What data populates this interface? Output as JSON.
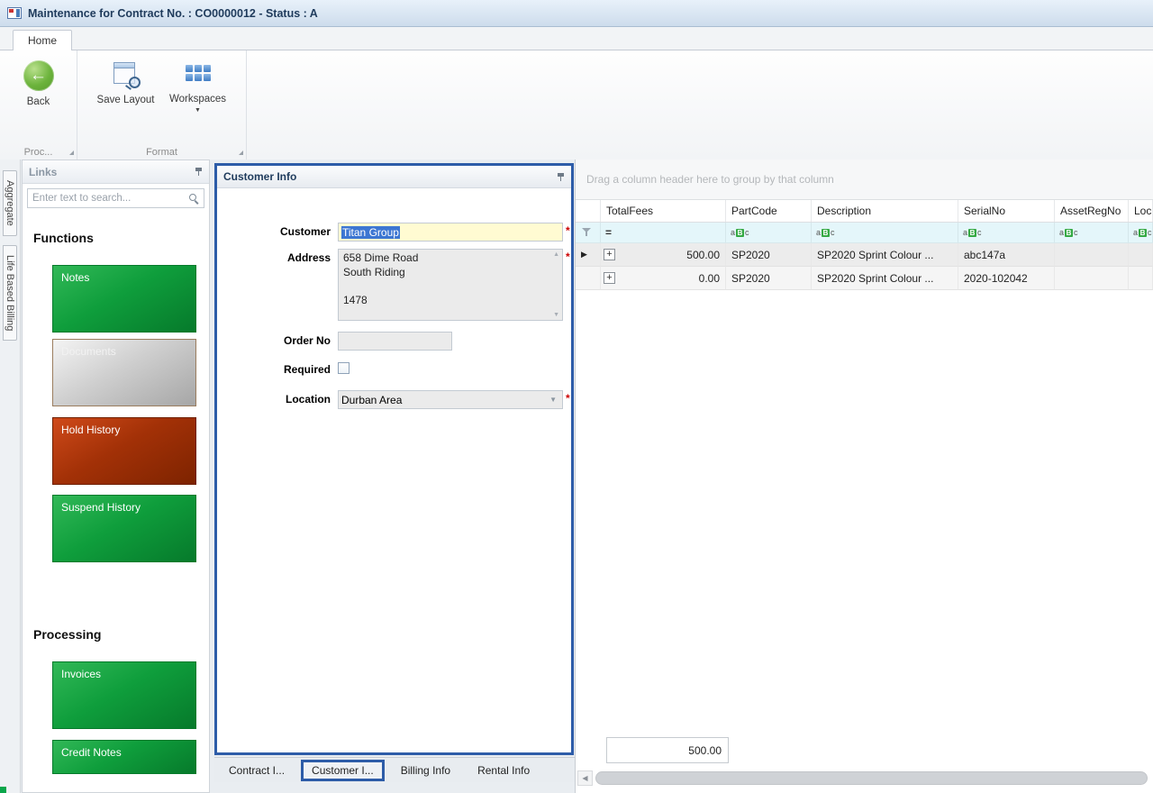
{
  "window": {
    "title": "Maintenance for Contract No. : CO0000012 - Status : A"
  },
  "ribbon": {
    "tabs": [
      {
        "label": "Home"
      }
    ],
    "buttons": [
      {
        "label": "Back"
      },
      {
        "label": "Save Layout"
      },
      {
        "label": "Workspaces"
      }
    ],
    "groups": [
      {
        "label": "Proc..."
      },
      {
        "label": "Format"
      }
    ]
  },
  "side_tabs": [
    "Aggregate",
    "Life Based Billing"
  ],
  "links_panel": {
    "title": "Links",
    "search_placeholder": "Enter text to search...",
    "sections": [
      {
        "heading": "Functions",
        "buttons": [
          {
            "label": "Notes",
            "style": "green"
          },
          {
            "label": "Documents",
            "style": "gray"
          },
          {
            "label": "Hold History",
            "style": "red"
          },
          {
            "label": "Suspend History",
            "style": "green"
          }
        ]
      },
      {
        "heading": "Processing",
        "buttons": [
          {
            "label": "Invoices",
            "style": "green"
          },
          {
            "label": "Credit Notes",
            "style": "green"
          }
        ]
      }
    ]
  },
  "customer_panel": {
    "title": "Customer Info",
    "fields": {
      "customer_label": "Customer",
      "customer_value": "Titan Group",
      "address_label": "Address",
      "address_value": "658 Dime Road\nSouth Riding\n\n1478",
      "order_no_label": "Order No",
      "order_no_value": "",
      "required_label": "Required",
      "required_checked": false,
      "location_label": "Location",
      "location_value": "Durban Area"
    },
    "tabs": [
      {
        "label": "Contract I...",
        "selected": false
      },
      {
        "label": "Customer I...",
        "selected": true
      },
      {
        "label": "Billing Info",
        "selected": false
      },
      {
        "label": "Rental Info",
        "selected": false
      }
    ]
  },
  "grid": {
    "group_hint": "Drag a column header here to group by that column",
    "columns": [
      "TotalFees",
      "PartCode",
      "Description",
      "SerialNo",
      "AssetRegNo",
      "Loc..."
    ],
    "filter_operator": "=",
    "rows": [
      {
        "cells": [
          "500.00",
          "SP2020",
          "SP2020 Sprint Colour ...",
          "abc147a",
          "",
          ""
        ]
      },
      {
        "cells": [
          "0.00",
          "SP2020",
          "SP2020 Sprint Colour ...",
          "2020-102042",
          "",
          ""
        ]
      }
    ],
    "summary_total": "500.00"
  },
  "colors": {
    "highlight_blue": "#2d5ca8",
    "button_green": "#0f9e3c",
    "button_red": "#a33107",
    "button_gray": "#cfcfcf",
    "field_yellow": "#fffbd2",
    "filter_row_bg": "#e4f6fa",
    "title_text": "#1f3b5c"
  }
}
